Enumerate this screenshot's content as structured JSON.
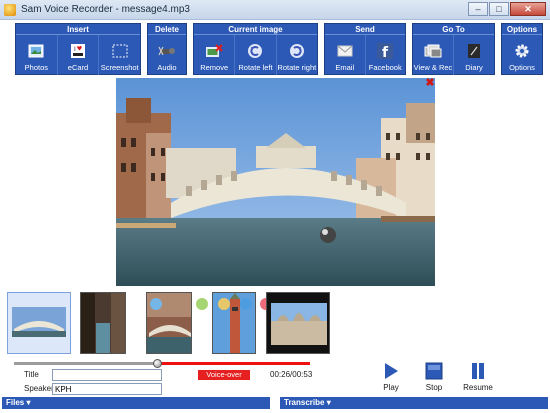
{
  "window": {
    "title": "Sam Voice Recorder - message4.mp3",
    "minimize": "–",
    "maximize": "□",
    "close": "✕"
  },
  "ribbon": {
    "insert": {
      "title": "Insert",
      "buttons": [
        {
          "label": "Photos",
          "icon": "photos-icon"
        },
        {
          "label": "eCard",
          "icon": "ecard-icon"
        },
        {
          "label": "Screenshot",
          "icon": "screenshot-icon"
        }
      ]
    },
    "delete": {
      "title": "Delete",
      "buttons": [
        {
          "label": "Audio",
          "icon": "audio-delete-icon"
        }
      ]
    },
    "current_image": {
      "title": "Current image",
      "buttons": [
        {
          "label": "Remove",
          "icon": "remove-image-icon"
        },
        {
          "label": "Rotate left",
          "icon": "rotate-left-icon"
        },
        {
          "label": "Rotate right",
          "icon": "rotate-right-icon"
        }
      ]
    },
    "send": {
      "title": "Send",
      "buttons": [
        {
          "label": "Email",
          "icon": "email-icon"
        },
        {
          "label": "Facebook",
          "icon": "facebook-icon"
        }
      ]
    },
    "goto": {
      "title": "Go To",
      "buttons": [
        {
          "label": "View & Rec",
          "icon": "view-rec-icon"
        },
        {
          "label": "Diary",
          "icon": "diary-icon"
        }
      ]
    },
    "options": {
      "title": "Options",
      "buttons": [
        {
          "label": "Options",
          "icon": "gear-icon"
        }
      ]
    }
  },
  "image_close": "✖",
  "controls": {
    "title_label": "Title",
    "title_value": "",
    "speaker_label": "Speaker",
    "speaker_value": "KPH",
    "voiceover": "Voice-over",
    "timecode": "00:26/00:53",
    "play": "Play",
    "stop": "Stop",
    "resume": "Resume"
  },
  "panels": {
    "files": "Files ▾",
    "transcribe": "Transcribe ▾"
  },
  "colors": {
    "ribbon_blue": "#2b59b5",
    "accent_red": "#ee1111"
  }
}
